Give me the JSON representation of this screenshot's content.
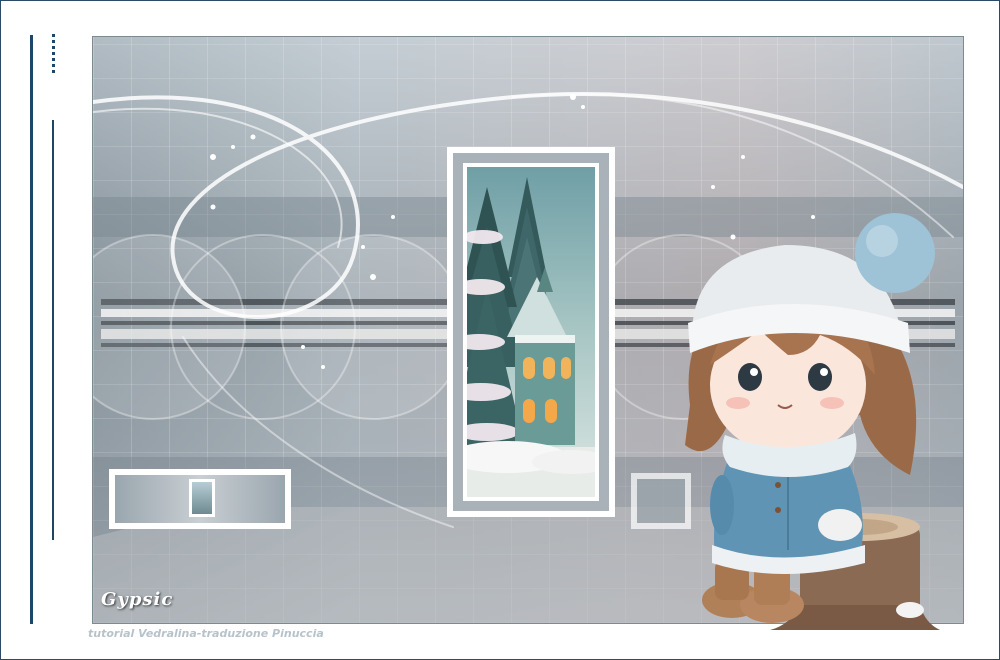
{
  "signature": "Gypsic",
  "credit_text": "tutorial Vedralina-traduzione Pinuccia",
  "colors": {
    "border_accent": "#1d4668",
    "background": "#ffffff",
    "hat": "#e9ecee",
    "pompom": "#9ec2d6",
    "coat": "#5f94b4"
  }
}
